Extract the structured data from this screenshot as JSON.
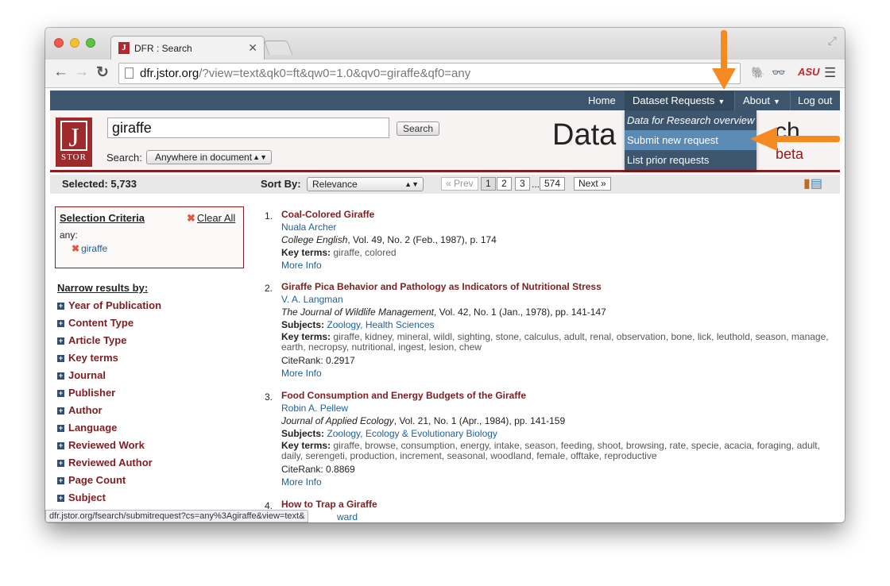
{
  "browser": {
    "tab_title": "DFR : Search",
    "url_host": "dfr.jstor.org",
    "url_path": "/?view=text&qk0=ft&qw0=1.0&qv0=giraffe&qf0=any",
    "favicon_letter": "J"
  },
  "topnav": {
    "home": "Home",
    "dataset_requests": "Dataset Requests",
    "about": "About",
    "logout": "Log out"
  },
  "dropdown": {
    "items": [
      "Data for Research overview",
      "Submit new request",
      "List prior requests"
    ]
  },
  "header": {
    "logo_letter": "J",
    "logo_text": "STOR",
    "search_value": "giraffe",
    "search_button": "Search",
    "scope_label": "Search:",
    "scope_value": "Anywhere in document",
    "title_visible": "Data",
    "title_tail": "ch",
    "beta": "beta"
  },
  "bar": {
    "selected": "Selected: 5,733",
    "sort_label": "Sort By:",
    "sort_value": "Relevance",
    "prev": "« Prev",
    "pages": [
      "1",
      "2",
      "3"
    ],
    "ellipsis": "...",
    "last_page": "574",
    "next": "Next »"
  },
  "criteria": {
    "title": "Selection Criteria",
    "clear_all": "Clear All",
    "field": "any:",
    "term": "giraffe"
  },
  "narrow": {
    "title": "Narrow results by:",
    "facets": [
      "Year of Publication",
      "Content Type",
      "Article Type",
      "Key terms",
      "Journal",
      "Publisher",
      "Author",
      "Language",
      "Reviewed Work",
      "Reviewed Author",
      "Page Count",
      "Subject"
    ]
  },
  "results": [
    {
      "num": "1.",
      "title": "Coal-Colored Giraffe",
      "author": "Nuala Archer",
      "journal": "College English",
      "citation": ", Vol. 49, No. 2 (Feb., 1987), p. 174",
      "keyterms": "giraffe, colored",
      "more": "More Info"
    },
    {
      "num": "2.",
      "title": "Giraffe Pica Behavior and Pathology as Indicators of Nutritional Stress",
      "author": "V. A. Langman",
      "journal": "The Journal of Wildlife Management",
      "citation": ", Vol. 42, No. 1 (Jan., 1978), pp. 141-147",
      "subjects": "Zoology, Health Sciences",
      "keyterms": "giraffe, kidney, mineral, wildl, sighting, stone, calculus, adult, renal, observation, bone, lick, leuthold, season, manage, earth, necropsy, nutritional, ingest, lesion, chew",
      "citerank": "CiteRank: 0.2917",
      "more": "More Info"
    },
    {
      "num": "3.",
      "title": "Food Consumption and Energy Budgets of the Giraffe",
      "author": "Robin A. Pellew",
      "journal": "Journal of Applied Ecology",
      "citation": ", Vol. 21, No. 1 (Apr., 1984), pp. 141-159",
      "subjects": "Zoology, Ecology & Evolutionary Biology",
      "keyterms": "giraffe, browse, consumption, energy, intake, season, feeding, shoot, browsing, rate, specie, acacia, foraging, adult, daily, serengeti, production, increment, seasonal, woodland, female, offtake, reproductive",
      "citerank": "CiteRank: 0.8869",
      "more": "More Info"
    },
    {
      "num": "4.",
      "title": "How to Trap a Giraffe",
      "author_partial": "ward"
    }
  ],
  "labels": {
    "subjects": "Subjects:",
    "keyterms": "Key terms:"
  },
  "status_bar": "dfr.jstor.org/fsearch/submitrequest?cs=any%3Agiraffe&view=text&",
  "colors": {
    "nav_bg": "#3d566e",
    "accent_red": "#8b1c21",
    "highlight": "#5b8ab5",
    "annotation_arrow": "#f58a23"
  }
}
